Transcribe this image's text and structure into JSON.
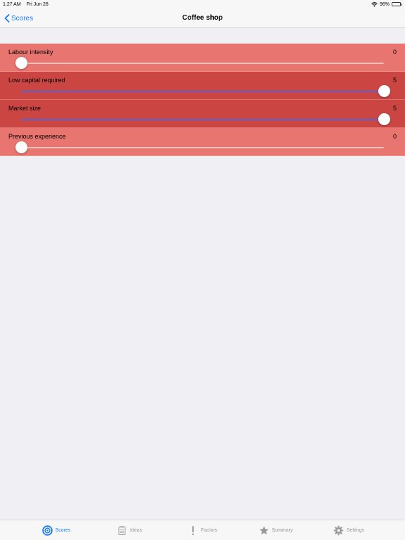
{
  "status_bar": {
    "time": "1:27 AM",
    "date": "Fri Jun 28",
    "battery": "96%",
    "battery_level": 0.96
  },
  "nav": {
    "back_label": "Scores",
    "title": "Coffee shop"
  },
  "scores": {
    "min": 0,
    "max": 5,
    "items": [
      {
        "label": "Labour intensity",
        "value": "0",
        "level": 0
      },
      {
        "label": "Low capital required",
        "value": "5",
        "level": 5
      },
      {
        "label": "Market size",
        "value": "5",
        "level": 5
      },
      {
        "label": "Previous experience",
        "value": "0",
        "level": 0
      }
    ]
  },
  "colors": {
    "accent": "#1a7cf4",
    "row_low": "#e8756f",
    "row_high": "#cb4643",
    "slider_fill": "#5a62c8"
  },
  "tabs": [
    {
      "label": "Scores",
      "icon": "target-icon",
      "active": true
    },
    {
      "label": "Ideas",
      "icon": "clipboard-icon",
      "active": false
    },
    {
      "label": "Factors",
      "icon": "exclamation-icon",
      "active": false
    },
    {
      "label": "Summary",
      "icon": "star-icon",
      "active": false
    },
    {
      "label": "Settings",
      "icon": "gear-icon",
      "active": false
    }
  ]
}
